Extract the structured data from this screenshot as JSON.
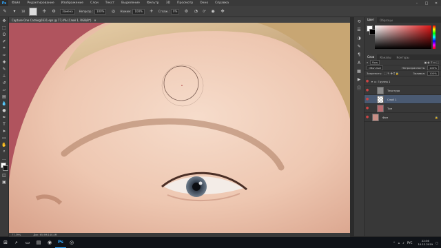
{
  "app": {
    "logo": "Ps"
  },
  "menu": [
    "Файл",
    "Редактирование",
    "Изображение",
    "Слои",
    "Текст",
    "Выделение",
    "Фильтр",
    "3D",
    "Просмотр",
    "Окно",
    "Справка"
  ],
  "options": {
    "brush_size": "18",
    "mode_value": "Замена",
    "opacity_label": "Непрозр.:",
    "opacity_value": "100%",
    "flow_label": "Нажим:",
    "flow_value": "100%",
    "smooth_label": "Сглаж.:",
    "smooth_value": "0%",
    "angle_value": "0°"
  },
  "document": {
    "tab_title": "Capture One Catalog0331.eps @ 77,4% (Слой 1, RGB/8*)",
    "zoom": "77,39%",
    "doc_info": "Док: 65,9M/140,4M"
  },
  "panel": {
    "tabs": [
      "Цвет",
      "Образцы"
    ],
    "sub_tabs": [
      "Слои",
      "Каналы",
      "Контуры"
    ],
    "kind_label": "Вид",
    "blend_mode": "Обычные",
    "opacity_label": "Непрозрачность:",
    "opacity_value": "100%",
    "lock_label": "Закрепить:",
    "fill_label": "Заливка:",
    "fill_value": "100%",
    "layers": [
      {
        "name": "Группа 1",
        "active": false
      },
      {
        "name": "Текстура",
        "active": false
      },
      {
        "name": "Слой 1",
        "active": true
      },
      {
        "name": "Тон",
        "active": false
      },
      {
        "name": "Фон",
        "active": false
      }
    ]
  },
  "taskbar": {
    "lang": "РУС",
    "time": "22:36",
    "date": "10.12.2019"
  },
  "colors": {
    "accent": "#31a8ff",
    "selected_layer": "#4a5a72",
    "backdrop": "#b0545e"
  }
}
